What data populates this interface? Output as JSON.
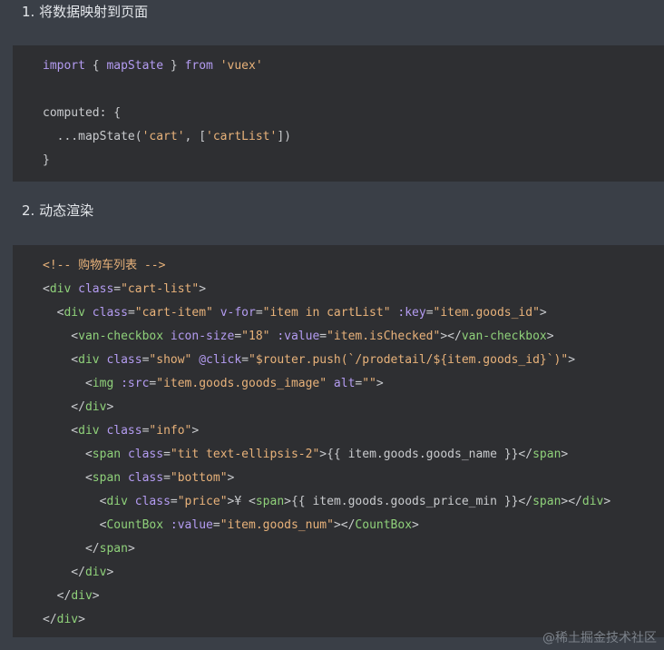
{
  "sections": [
    {
      "heading": "1. 将数据映射到页面",
      "code": [
        [
          [
            "kw",
            "import"
          ],
          [
            "pun",
            " { "
          ],
          [
            "kw",
            "mapState"
          ],
          [
            "pun",
            " } "
          ],
          [
            "kw",
            "from"
          ],
          [
            "pun",
            " "
          ],
          [
            "str",
            "'vuex'"
          ]
        ],
        [],
        [
          [
            "fn",
            "computed: {"
          ]
        ],
        [
          [
            "fn",
            "  ...mapState("
          ],
          [
            "str",
            "'cart'"
          ],
          [
            "pun",
            ", ["
          ],
          [
            "str",
            "'cartList'"
          ],
          [
            "pun",
            "])"
          ]
        ],
        [
          [
            "pun",
            "}"
          ]
        ]
      ]
    },
    {
      "heading": "2. 动态渲染",
      "code": [
        [
          [
            "cmt",
            "<!-- 购物车列表 -->"
          ]
        ],
        [
          [
            "pun",
            "<"
          ],
          [
            "tag",
            "div"
          ],
          [
            "pun",
            " "
          ],
          [
            "attr",
            "class"
          ],
          [
            "pun",
            "="
          ],
          [
            "str",
            "\"cart-list\""
          ],
          [
            "pun",
            ">"
          ]
        ],
        [
          [
            "pun",
            "  <"
          ],
          [
            "tag",
            "div"
          ],
          [
            "pun",
            " "
          ],
          [
            "attr",
            "class"
          ],
          [
            "pun",
            "="
          ],
          [
            "str",
            "\"cart-item\""
          ],
          [
            "pun",
            " "
          ],
          [
            "attr",
            "v-for"
          ],
          [
            "pun",
            "="
          ],
          [
            "str",
            "\"item in cartList\""
          ],
          [
            "pun",
            " "
          ],
          [
            "attr",
            ":key"
          ],
          [
            "pun",
            "="
          ],
          [
            "str",
            "\"item.goods_id\""
          ],
          [
            "pun",
            ">"
          ]
        ],
        [
          [
            "pun",
            "    <"
          ],
          [
            "tag",
            "van-checkbox"
          ],
          [
            "pun",
            " "
          ],
          [
            "attr",
            "icon-size"
          ],
          [
            "pun",
            "="
          ],
          [
            "str",
            "\"18\""
          ],
          [
            "pun",
            " "
          ],
          [
            "attr",
            ":value"
          ],
          [
            "pun",
            "="
          ],
          [
            "str",
            "\"item.isChecked\""
          ],
          [
            "pun",
            "></"
          ],
          [
            "tag",
            "van-checkbox"
          ],
          [
            "pun",
            ">"
          ]
        ],
        [
          [
            "pun",
            "    <"
          ],
          [
            "tag",
            "div"
          ],
          [
            "pun",
            " "
          ],
          [
            "attr",
            "class"
          ],
          [
            "pun",
            "="
          ],
          [
            "str",
            "\"show\""
          ],
          [
            "pun",
            " "
          ],
          [
            "attr",
            "@click"
          ],
          [
            "pun",
            "="
          ],
          [
            "str",
            "\"$router.push(`/prodetail/${item.goods_id}`)\""
          ],
          [
            "pun",
            ">"
          ]
        ],
        [
          [
            "pun",
            "      <"
          ],
          [
            "tag",
            "img"
          ],
          [
            "pun",
            " "
          ],
          [
            "attr",
            ":src"
          ],
          [
            "pun",
            "="
          ],
          [
            "str",
            "\"item.goods.goods_image\""
          ],
          [
            "pun",
            " "
          ],
          [
            "attr",
            "alt"
          ],
          [
            "pun",
            "="
          ],
          [
            "str",
            "\"\""
          ],
          [
            "pun",
            ">"
          ]
        ],
        [
          [
            "pun",
            "    </"
          ],
          [
            "tag",
            "div"
          ],
          [
            "pun",
            ">"
          ]
        ],
        [
          [
            "pun",
            "    <"
          ],
          [
            "tag",
            "div"
          ],
          [
            "pun",
            " "
          ],
          [
            "attr",
            "class"
          ],
          [
            "pun",
            "="
          ],
          [
            "str",
            "\"info\""
          ],
          [
            "pun",
            ">"
          ]
        ],
        [
          [
            "pun",
            "      <"
          ],
          [
            "tag",
            "span"
          ],
          [
            "pun",
            " "
          ],
          [
            "attr",
            "class"
          ],
          [
            "pun",
            "="
          ],
          [
            "str",
            "\"tit text-ellipsis-2\""
          ],
          [
            "pun",
            ">{{ item.goods.goods_name }}</"
          ],
          [
            "tag",
            "span"
          ],
          [
            "pun",
            ">"
          ]
        ],
        [
          [
            "pun",
            "      <"
          ],
          [
            "tag",
            "span"
          ],
          [
            "pun",
            " "
          ],
          [
            "attr",
            "class"
          ],
          [
            "pun",
            "="
          ],
          [
            "str",
            "\"bottom\""
          ],
          [
            "pun",
            ">"
          ]
        ],
        [
          [
            "pun",
            "        <"
          ],
          [
            "tag",
            "div"
          ],
          [
            "pun",
            " "
          ],
          [
            "attr",
            "class"
          ],
          [
            "pun",
            "="
          ],
          [
            "str",
            "\"price\""
          ],
          [
            "pun",
            ">¥ <"
          ],
          [
            "tag",
            "span"
          ],
          [
            "pun",
            ">{{ item.goods.goods_price_min }}</"
          ],
          [
            "tag",
            "span"
          ],
          [
            "pun",
            "></"
          ],
          [
            "tag",
            "div"
          ],
          [
            "pun",
            ">"
          ]
        ],
        [
          [
            "pun",
            "        <"
          ],
          [
            "tag",
            "CountBox"
          ],
          [
            "pun",
            " "
          ],
          [
            "attr",
            ":value"
          ],
          [
            "pun",
            "="
          ],
          [
            "str",
            "\"item.goods_num\""
          ],
          [
            "pun",
            "></"
          ],
          [
            "tag",
            "CountBox"
          ],
          [
            "pun",
            ">"
          ]
        ],
        [
          [
            "pun",
            "      </"
          ],
          [
            "tag",
            "span"
          ],
          [
            "pun",
            ">"
          ]
        ],
        [
          [
            "pun",
            "    </"
          ],
          [
            "tag",
            "div"
          ],
          [
            "pun",
            ">"
          ]
        ],
        [
          [
            "pun",
            "  </"
          ],
          [
            "tag",
            "div"
          ],
          [
            "pun",
            ">"
          ]
        ],
        [
          [
            "pun",
            "</"
          ],
          [
            "tag",
            "div"
          ],
          [
            "pun",
            ">"
          ]
        ]
      ]
    }
  ],
  "watermark": "@稀土掘金技术社区",
  "colors": {
    "page_bg": "#3a3f47",
    "code_bg": "#2e2f32",
    "keyword": "#b49cf2",
    "string": "#e8b27a",
    "tag": "#8fd17a",
    "text": "#c9cbce"
  }
}
